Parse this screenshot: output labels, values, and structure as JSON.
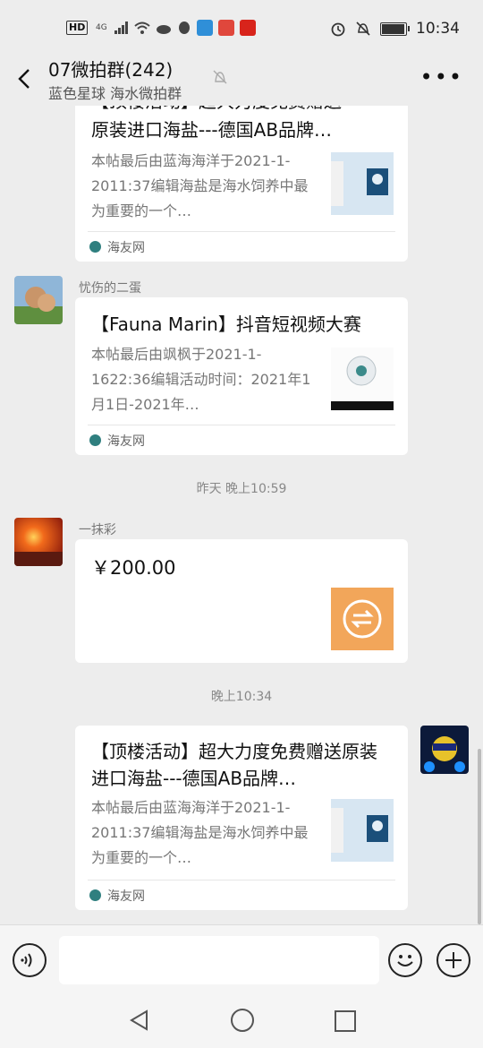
{
  "status_bar": {
    "hd": "HD",
    "network": "4G",
    "time": "10:34",
    "battery_level": 0.9
  },
  "header": {
    "title": "07微拍群(242)",
    "subtitle": "蓝色星球 海水微拍群",
    "icons": [
      "back-arrow-icon",
      "mute-bell-icon",
      "more-icon"
    ]
  },
  "messages": {
    "card1": {
      "title_partial": "【顶楼活动】超大力度免费赠送",
      "title_line2": "原装进口海盐---德国AB品牌…",
      "desc": "本帖最后由蓝海海洋于2021-1-2011:37编辑海盐是海水饲养中最为重要的一个…",
      "source": "海友网"
    },
    "msg2": {
      "nickname": "忧伤的二蛋",
      "title": "【Fauna Marin】抖音短视频大赛",
      "desc": "本帖最后由飒枫于2021-1-1622:36编辑活动时间：2021年1月1日-2021年…",
      "source": "海友网"
    },
    "timestamp1": "昨天 晚上10:59",
    "msg3": {
      "nickname": "一抹彩",
      "amount": "￥200.00",
      "icon": "transfer-icon"
    },
    "timestamp2": "晚上10:34",
    "msg4": {
      "title": "【顶楼活动】超大力度免费赠送原装进口海盐---德国AB品牌…",
      "desc": "本帖最后由蓝海海洋于2021-1-2011:37编辑海盐是海水饲养中最为重要的一个…",
      "source": "海友网"
    }
  },
  "input_bar": {
    "icons": [
      "voice-icon",
      "emoji-icon",
      "plus-icon"
    ],
    "placeholder": ""
  },
  "colors": {
    "background": "#ededed",
    "card": "#ffffff",
    "transfer": "#f2a65a"
  }
}
